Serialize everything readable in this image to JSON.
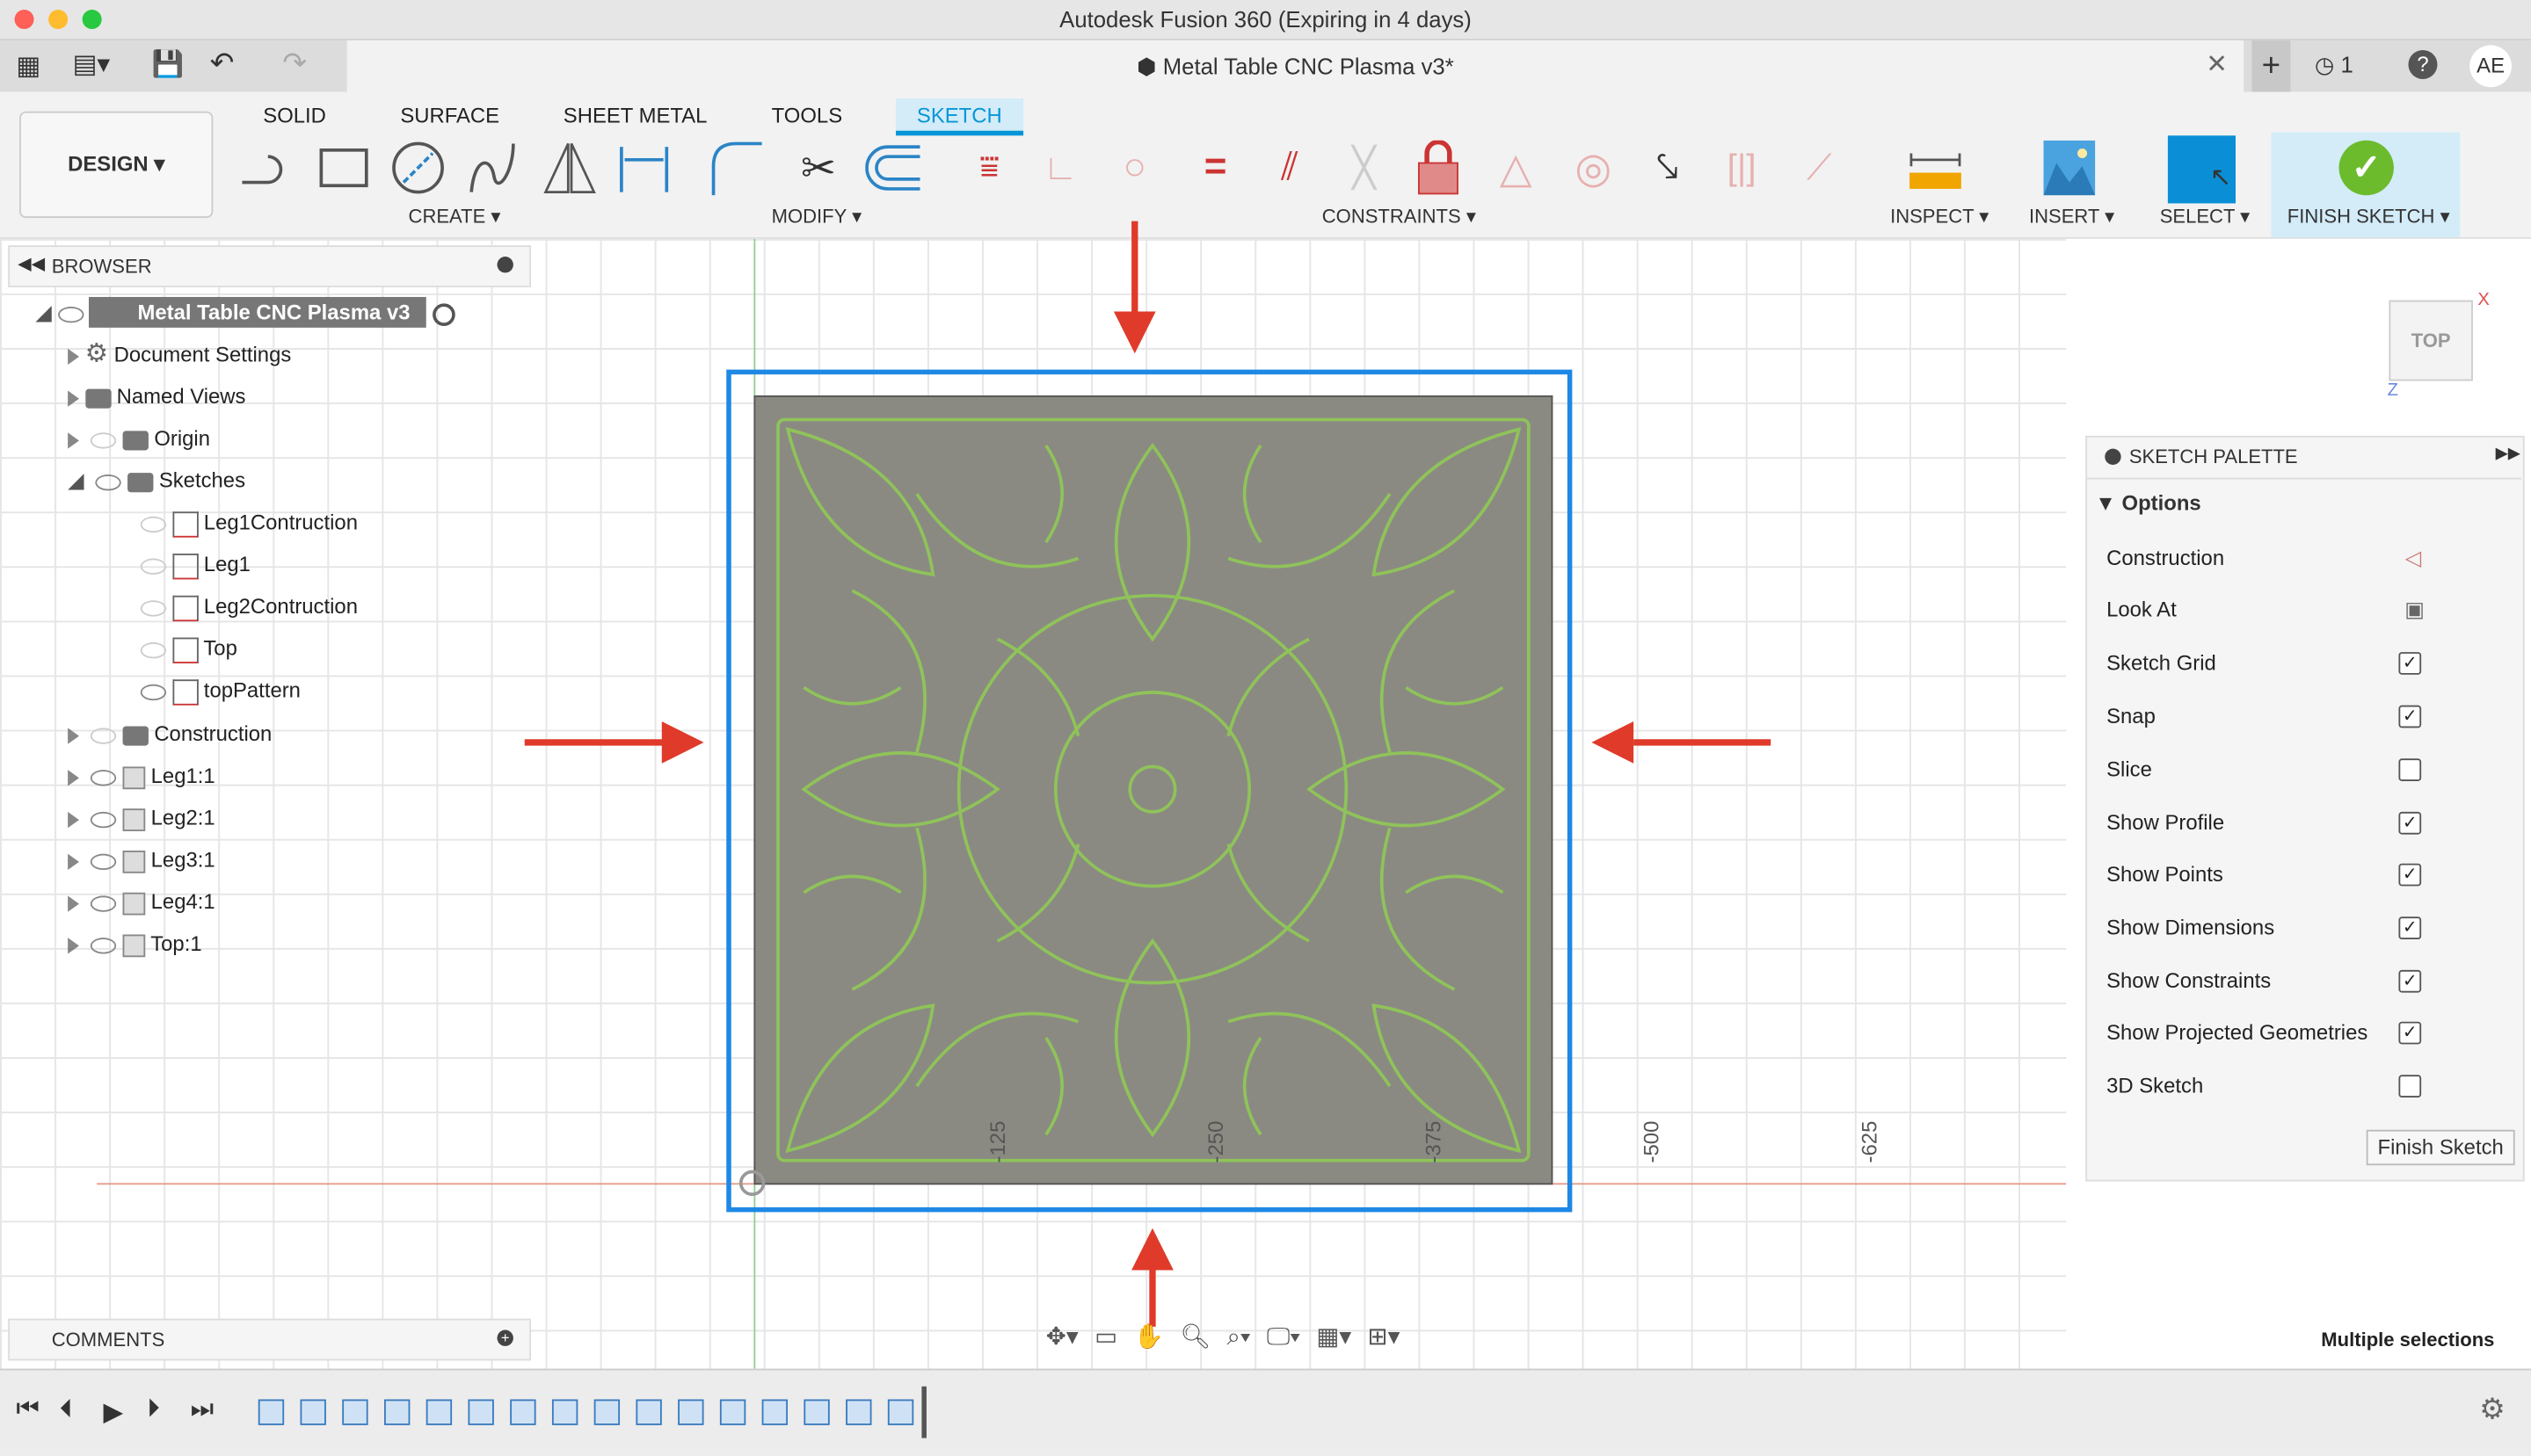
{
  "window": {
    "title": "Autodesk Fusion 360 (Expiring in 4 days)",
    "document_tab": "Metal Table CNC Plasma v3*",
    "job_count": "1",
    "user_initials": "AE"
  },
  "ribbon": {
    "workspace": "DESIGN",
    "tabs": [
      {
        "label": "SOLID"
      },
      {
        "label": "SURFACE"
      },
      {
        "label": "SHEET METAL"
      },
      {
        "label": "TOOLS"
      },
      {
        "label": "SKETCH",
        "active": true
      }
    ],
    "groups": {
      "create": "CREATE",
      "modify": "MODIFY",
      "constraints": "CONSTRAINTS",
      "inspect": "INSPECT",
      "insert": "INSERT",
      "select": "SELECT",
      "finish": "FINISH SKETCH"
    },
    "accent": "#0696d7"
  },
  "browser": {
    "title": "BROWSER",
    "root": "Metal Table CNC Plasma v3",
    "items": [
      {
        "label": "Document Settings"
      },
      {
        "label": "Named Views"
      },
      {
        "label": "Origin"
      },
      {
        "label": "Sketches"
      },
      {
        "label": "Leg1Contruction"
      },
      {
        "label": "Leg1"
      },
      {
        "label": "Leg2Contruction"
      },
      {
        "label": "Top"
      },
      {
        "label": "topPattern"
      },
      {
        "label": "Construction"
      },
      {
        "label": "Leg1:1"
      },
      {
        "label": "Leg2:1"
      },
      {
        "label": "Leg3:1"
      },
      {
        "label": "Leg4:1"
      },
      {
        "label": "Top:1"
      }
    ]
  },
  "comments": {
    "title": "COMMENTS"
  },
  "viewcube": {
    "face": "TOP",
    "x": "X",
    "z": "Z"
  },
  "canvas": {
    "axis_labels": [
      "-125",
      "-250",
      "-375",
      "-500",
      "-625"
    ],
    "status": "Multiple selections",
    "selection_color": "#1e88e5",
    "arrow_color": "#e03a2a",
    "pattern_color": "#8fc35a"
  },
  "palette": {
    "title": "SKETCH PALETTE",
    "section": "Options",
    "options": [
      {
        "label": "Construction",
        "type": "icon"
      },
      {
        "label": "Look At",
        "type": "icon"
      },
      {
        "label": "Sketch Grid",
        "checked": true
      },
      {
        "label": "Snap",
        "checked": true
      },
      {
        "label": "Slice",
        "checked": false
      },
      {
        "label": "Show Profile",
        "checked": true
      },
      {
        "label": "Show Points",
        "checked": true
      },
      {
        "label": "Show Dimensions",
        "checked": true
      },
      {
        "label": "Show Constraints",
        "checked": true
      },
      {
        "label": "Show Projected Geometries",
        "checked": true
      },
      {
        "label": "3D Sketch",
        "checked": false
      }
    ],
    "finish_button": "Finish Sketch"
  }
}
